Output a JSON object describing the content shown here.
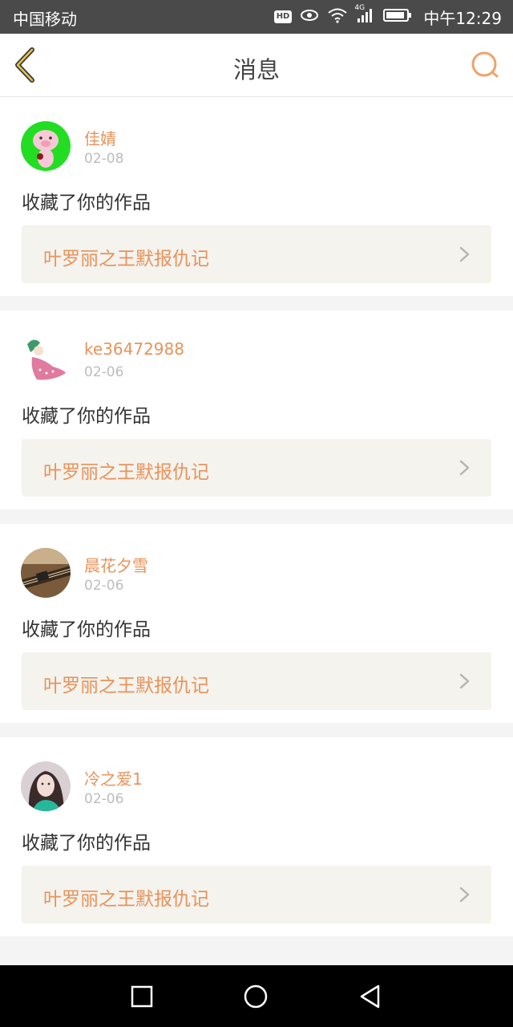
{
  "status_bar": {
    "carrier": "中国移动",
    "hd_badge": "HD",
    "network": "4G",
    "time": "中午12:29"
  },
  "header": {
    "title": "消息",
    "back_icon": "chevron-left-icon",
    "search_icon": "search-icon",
    "accent_color": "#e8935a"
  },
  "messages": [
    {
      "user": "佳婧",
      "date": "02-08",
      "action": "收藏了你的作品",
      "work_title": "叶罗丽之王默报仇记",
      "avatar": "pink-pig-avatar"
    },
    {
      "user": "ke36472988",
      "date": "02-06",
      "action": "收藏了你的作品",
      "work_title": "叶罗丽之王默报仇记",
      "avatar": "pink-doll-avatar"
    },
    {
      "user": "晨花夕雪",
      "date": "02-06",
      "action": "收藏了你的作品",
      "work_title": "叶罗丽之王默报仇记",
      "avatar": "guzheng-photo-avatar"
    },
    {
      "user": "冷之爱1",
      "date": "02-06",
      "action": "收藏了你的作品",
      "work_title": "叶罗丽之王默报仇记",
      "avatar": "girl-photo-avatar"
    }
  ],
  "system_nav": {
    "recent_icon": "square-icon",
    "home_icon": "circle-icon",
    "back_icon": "triangle-back-icon"
  }
}
